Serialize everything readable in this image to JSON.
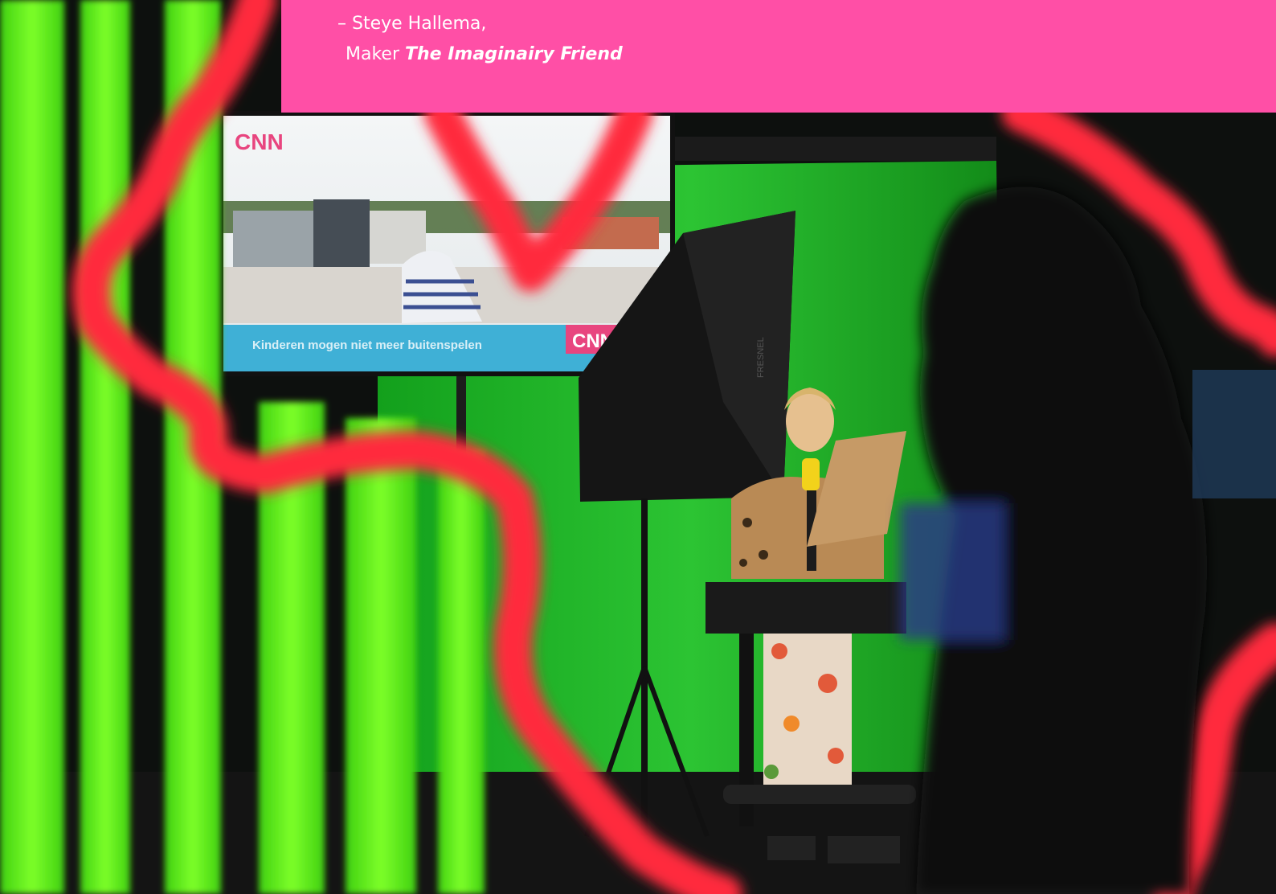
{
  "quote": {
    "attribution_line1": "– Steye Hallema,",
    "attribution_role": "Maker",
    "attribution_work": "The Imaginairy Friend"
  },
  "photo": {
    "tv": {
      "logo_top": "CNN",
      "ticker_text": "Kinderen mogen niet meer buitenspelen",
      "logo_ticker": "CNN"
    },
    "softbox_brand": "FRESNEL"
  },
  "colors": {
    "accent_pink": "#ff4fa6",
    "neon_green": "#5ef01a",
    "neon_red": "#ff2a3c",
    "greenscreen": "#1fb32a"
  }
}
